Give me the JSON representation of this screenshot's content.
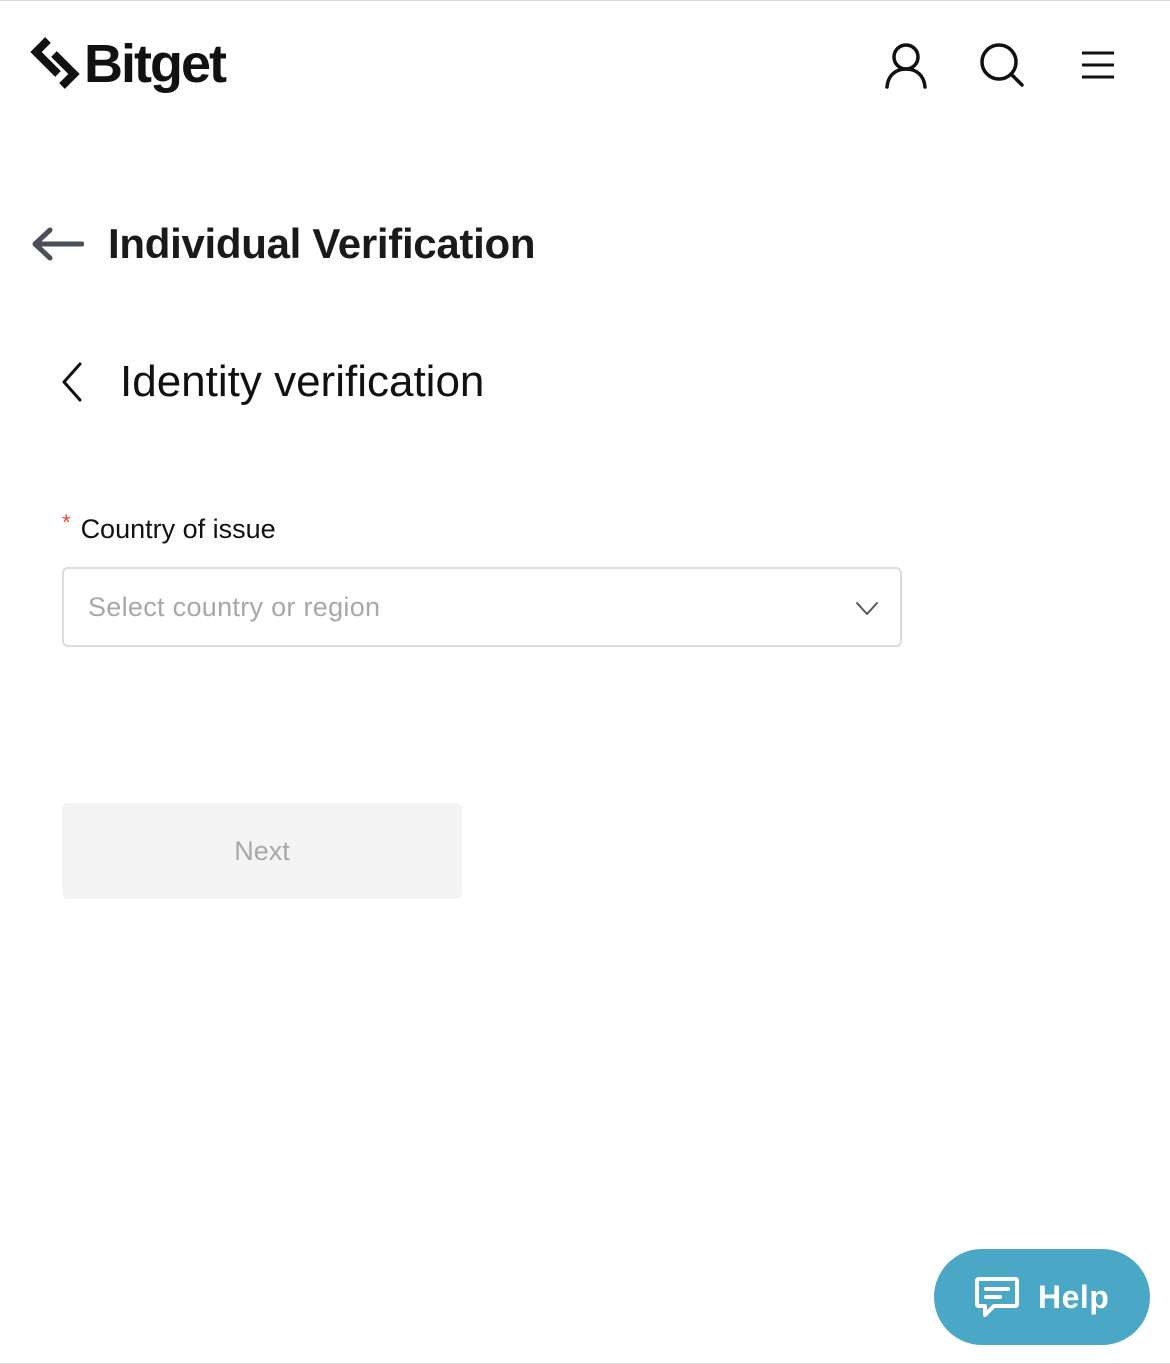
{
  "header": {
    "brand": "Bitget",
    "icons": [
      "user-icon",
      "search-icon",
      "menu-icon"
    ]
  },
  "title": {
    "text": "Individual Verification"
  },
  "step": {
    "title": "Identity verification"
  },
  "form": {
    "country": {
      "required_mark": "*",
      "label": "Country of issue",
      "placeholder": "Select country or region"
    },
    "next_label": "Next"
  },
  "help": {
    "label": "Help"
  },
  "colors": {
    "help_bg": "#4aa8c6",
    "required": "#e04a3b",
    "disabled_bg": "#f4f4f4",
    "disabled_text": "#a8a8a8"
  }
}
